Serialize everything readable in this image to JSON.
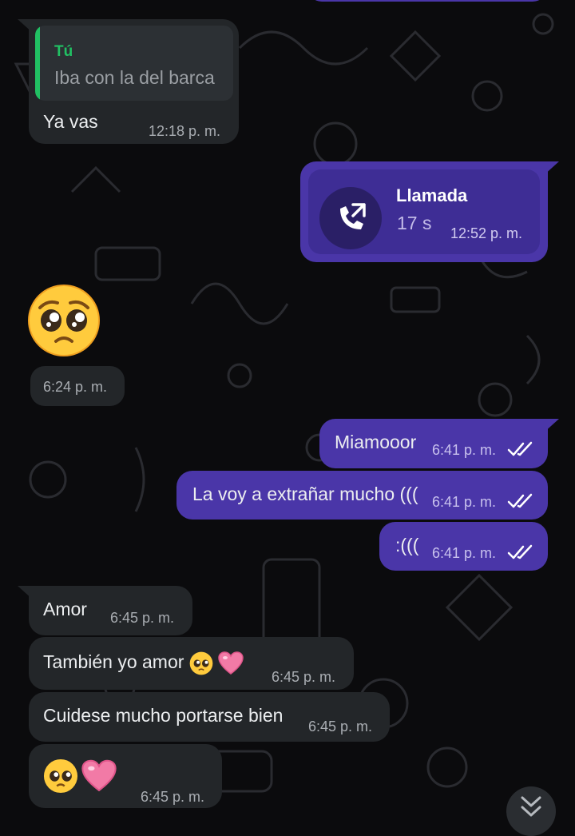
{
  "colors": {
    "background": "#0b0b0d",
    "incoming_bubble": "#232629",
    "outgoing_bubble": "#4a36a8",
    "quote_accent": "#21c063",
    "read_ticks": "#ffffff"
  },
  "messages": [
    {
      "direction": "incoming",
      "quote": {
        "author": "Tú",
        "text": "Iba con la del barca"
      },
      "text": "Ya vas",
      "time": "12:18 p. m."
    },
    {
      "direction": "outgoing",
      "type": "call",
      "call": {
        "title": "Llamada",
        "duration": "17 s",
        "icon": "outgoing-call-icon"
      },
      "time": "12:52 p. m."
    },
    {
      "direction": "incoming",
      "type": "emoji",
      "emoji": "pleading-face",
      "time": "6:24 p. m."
    },
    {
      "direction": "outgoing",
      "text": "Miamooor",
      "time": "6:41 p. m.",
      "status": "read"
    },
    {
      "direction": "outgoing",
      "text": "La voy a extrañar mucho (((",
      "time": "6:41 p. m.",
      "status": "read"
    },
    {
      "direction": "outgoing",
      "text": ":(((",
      "time": "6:41 p. m.",
      "status": "read"
    },
    {
      "direction": "incoming",
      "text": "Amor",
      "time": "6:45 p. m."
    },
    {
      "direction": "incoming",
      "text": "También yo amor",
      "emojis": [
        "pleading-face",
        "pink-heart"
      ],
      "time": "6:45 p. m."
    },
    {
      "direction": "incoming",
      "text": "Cuidese mucho portarse bien",
      "time": "6:45 p. m."
    },
    {
      "direction": "incoming",
      "emojis": [
        "pleading-face",
        "pink-heart"
      ],
      "time": "6:45 p. m."
    }
  ],
  "scroll_button": {
    "icon": "double-chevron-down-icon"
  }
}
